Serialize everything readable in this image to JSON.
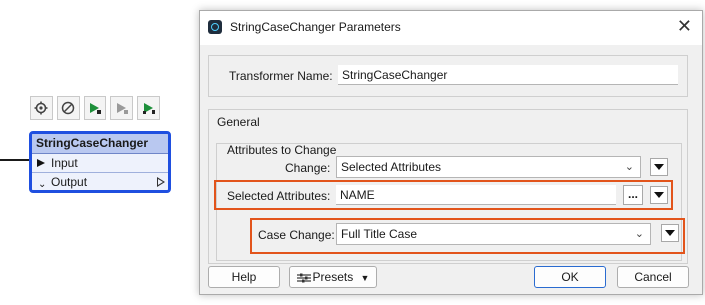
{
  "node": {
    "title": "StringCaseChanger",
    "ports": [
      {
        "label": "Input",
        "kind": "input"
      },
      {
        "label": "Output",
        "kind": "output"
      }
    ],
    "toolbar_icons": [
      "gear-icon",
      "disable-icon",
      "run-to-this-icon",
      "run-from-this-icon",
      "run-just-this-icon"
    ],
    "accent": "#1f4fe0"
  },
  "dialog": {
    "title": "StringCaseChanger Parameters",
    "close_glyph": "✕",
    "transformer_name_label": "Transformer Name:",
    "transformer_name_value": "StringCaseChanger",
    "general_group": "General",
    "attributes_group": "Attributes to Change",
    "change_label": "Change:",
    "change_value": "Selected Attributes",
    "selected_attributes_label": "Selected Attributes:",
    "selected_attributes_value": "NAME",
    "ellipsis_label": "...",
    "case_change_label": "Case Change:",
    "case_change_value": "Full Title Case",
    "help_label": "Help",
    "presets_label": "Presets",
    "ok_label": "OK",
    "cancel_label": "Cancel",
    "highlight_color": "#e2541b"
  }
}
